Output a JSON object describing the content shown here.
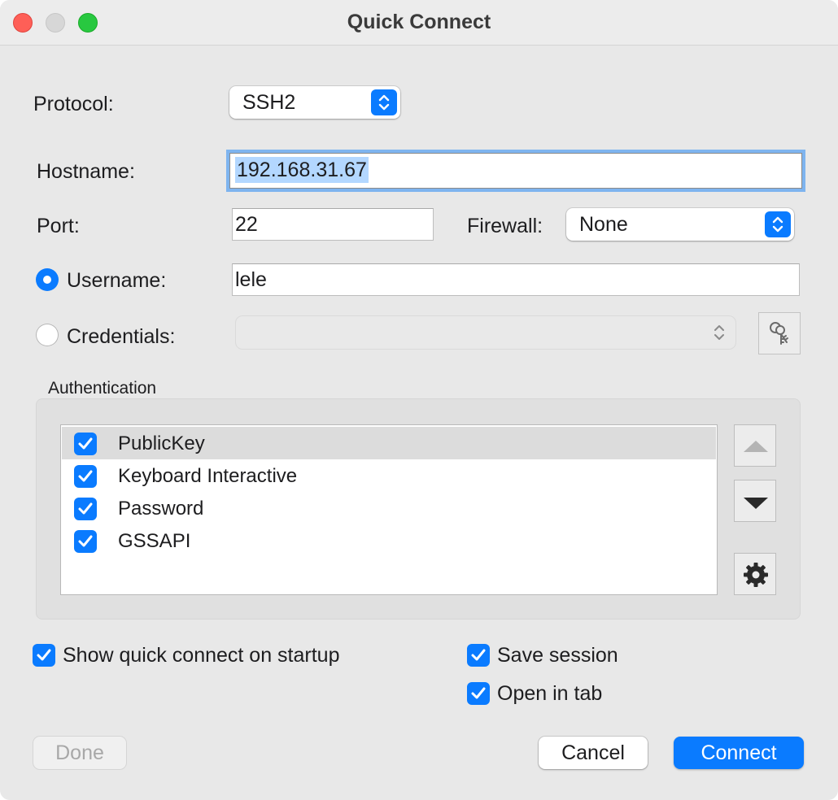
{
  "window": {
    "title": "Quick Connect"
  },
  "protocol": {
    "label": "Protocol:",
    "value": "SSH2"
  },
  "hostname": {
    "label": "Hostname:",
    "value": "192.168.31.67"
  },
  "port": {
    "label": "Port:",
    "value": "22"
  },
  "firewall": {
    "label": "Firewall:",
    "value": "None"
  },
  "username": {
    "label": "Username:",
    "value": "lele",
    "selected": true
  },
  "credentials": {
    "label": "Credentials:",
    "value": "",
    "selected": false
  },
  "authentication": {
    "title": "Authentication",
    "methods": [
      {
        "label": "PublicKey",
        "checked": true,
        "selected": true
      },
      {
        "label": "Keyboard Interactive",
        "checked": true,
        "selected": false
      },
      {
        "label": "Password",
        "checked": true,
        "selected": false
      },
      {
        "label": "GSSAPI",
        "checked": true,
        "selected": false
      }
    ]
  },
  "options": {
    "show_on_startup": {
      "label": "Show quick connect on startup",
      "checked": true
    },
    "save_session": {
      "label": "Save session",
      "checked": true
    },
    "open_in_tab": {
      "label": "Open in tab",
      "checked": true
    }
  },
  "buttons": {
    "done": "Done",
    "cancel": "Cancel",
    "connect": "Connect"
  },
  "colors": {
    "accent": "#0a7bff",
    "selection": "#b3d7ff",
    "focus_ring": "#7eb4ef"
  },
  "icons": [
    "stepper-icon",
    "keys-icon",
    "arrow-up-icon",
    "arrow-down-icon",
    "gear-icon",
    "checkmark-icon"
  ]
}
